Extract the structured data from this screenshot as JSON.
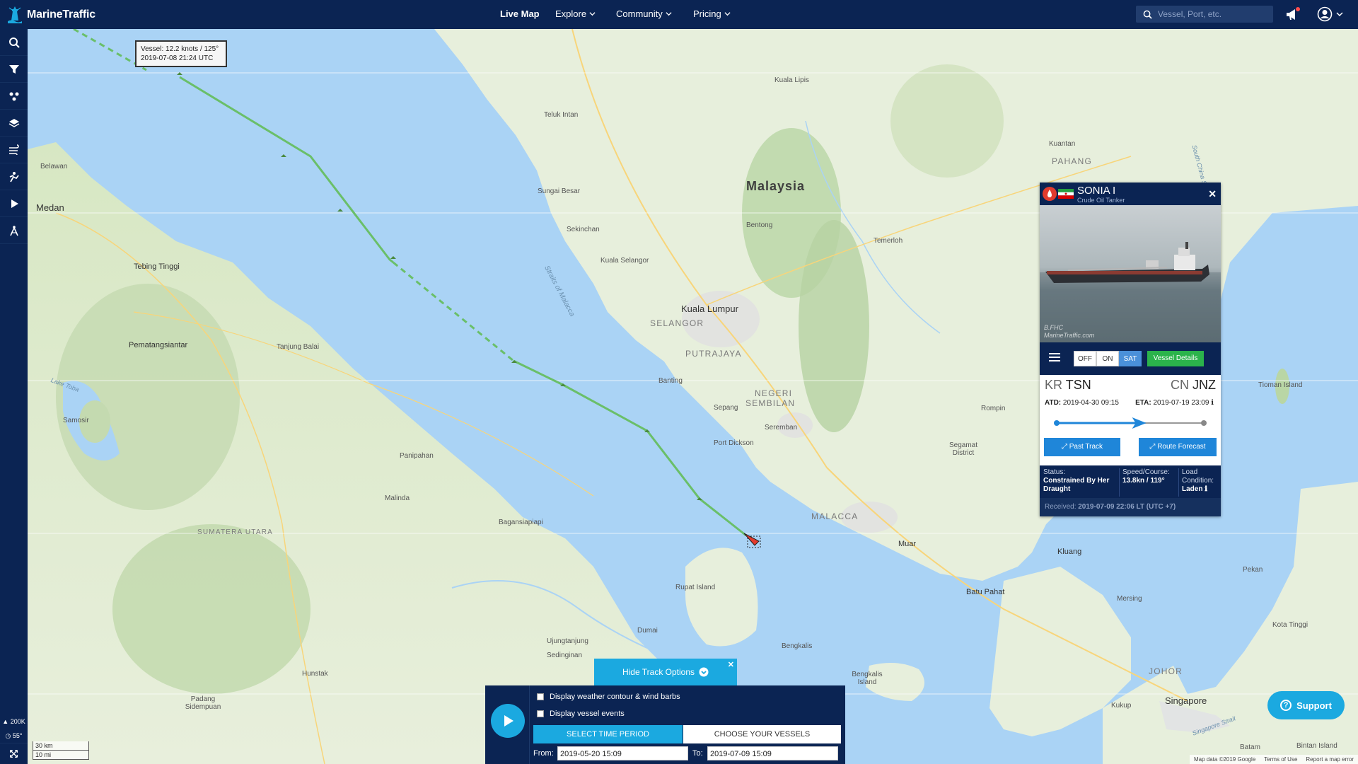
{
  "app": {
    "name": "MarineTraffic",
    "nav": [
      "Live Map",
      "Explore",
      "Community",
      "Pricing"
    ],
    "search_placeholder": "Vessel, Port, etc."
  },
  "sidebar": {
    "icons": [
      "search-icon",
      "filter-icon",
      "fleet-icon",
      "layers-icon",
      "weather-icon",
      "density-icon",
      "play-icon",
      "measure-icon",
      "fullscreen-icon"
    ],
    "zoom_label": "200K",
    "heading_label": "55°"
  },
  "map": {
    "tooltip": {
      "line1": "Vessel: 12.2 knots / 125°",
      "line2": "2019-07-08 21:24 UTC"
    },
    "labels": {
      "country_malaysia": "Malaysia",
      "kuala_lumpur": "Kuala Lumpur",
      "selangor": "SELANGOR",
      "putrajaya": "PUTRAJAYA",
      "negeri": "NEGERI",
      "sembilan": "SEMBILAN",
      "malacca": "MALACCA",
      "johor": "JOHOR",
      "pahang": "PAHANG",
      "singapore": "Singapore",
      "medan": "Medan",
      "belawan": "Belawan",
      "sumatera": "SUMATERA UTARA",
      "straits": "Straits of Malacca",
      "south_china_sea": "South China Sea",
      "singapore_strait": "Singapore Strait",
      "port_dickson": "Port Dickson",
      "seremban": "Seremban",
      "kuala_selangor": "Kuala Selangor",
      "sekinchan": "Sekinchan",
      "banting": "Banting",
      "sepang": "Sepang",
      "dumai": "Dumai",
      "rupat": "Rupat Island",
      "bengkalis": "Bengkalis",
      "bengkalis_island": "Bengkalis Island",
      "batu_pahat": "Batu Pahat",
      "kluang": "Kluang",
      "muar": "Muar",
      "segamat": "Segamat District",
      "tioman": "Tioman Island",
      "samosir": "Samosir",
      "tebing_tinggi": "Tebing Tinggi",
      "pematangsiantar": "Pematangsiantar",
      "tanjung_balai": "Tanjung Balai",
      "panipahan": "Panipahan",
      "bagansiapiapi": "Bagansiapiapi",
      "malinda": "Malinda",
      "kuala_lipis": "Kuala Lipis",
      "bentong": "Bentong",
      "temerloh": "Temerloh",
      "kuantan": "Kuantan",
      "teluk_intan": "Teluk Intan",
      "sungai_besar": "Sungai Besar",
      "kukup": "Kukup",
      "batam": "Batam",
      "bintan": "Bintan Island",
      "kota_tinggi": "Kota Tinggi",
      "ujung_tanjung": "Ujungtanjung",
      "sedinginan": "Sedinginan",
      "hunstak": "Hunstak",
      "padang_sidempuan": "Padang Sidempuan",
      "lake_toba": "Lake Toba",
      "rompin": "Rompin",
      "mersing": "Mersing",
      "pekan": "Pekan"
    },
    "scale_km": "30 km",
    "scale_mi": "10 mi",
    "attribution": [
      "Map data ©2019 Google",
      "Terms of Use",
      "Report a map error"
    ]
  },
  "vessel": {
    "name": "SONIA I",
    "type": "Crude Oil Tanker",
    "photo_credit_1": "B.FHC",
    "photo_credit_2": "MarineTraffic.com",
    "toggles": [
      "OFF",
      "ON",
      "SAT"
    ],
    "details_label": "Vessel Details",
    "dep_country": "KR",
    "dep_port": "TSN",
    "arr_country": "CN",
    "arr_port": "JNZ",
    "atd_label": "ATD:",
    "atd": "2019-04-30 09:15",
    "eta_label": "ETA:",
    "eta": "2019-07-19 23:09",
    "progress_fraction": 0.58,
    "past_track_label": "Past Track",
    "route_forecast_label": "Route Forecast",
    "status_label": "Status:",
    "status_value": "Constrained By Her Draught",
    "speed_label": "Speed/Course:",
    "speed_value": "13.8kn / 119°",
    "load_label": "Load Condition:",
    "load_value": "Laden",
    "received_label": "Received:",
    "received_value": "2019-07-09 22:06 LT (UTC +7)"
  },
  "track": {
    "hide_label": "Hide Track Options",
    "weather_label": "Display weather contour & wind barbs",
    "events_label": "Display vessel events",
    "tab_time": "SELECT TIME PERIOD",
    "tab_vessels": "CHOOSE YOUR VESSELS",
    "from_label": "From:",
    "from_value": "2019-05-20 15:09",
    "to_label": "To:",
    "to_value": "2019-07-09 15:09"
  },
  "support_label": "Support",
  "colors": {
    "navy": "#0b2453",
    "accent": "#1ba9e0",
    "green": "#2bb34b",
    "track": "#6abf69"
  }
}
